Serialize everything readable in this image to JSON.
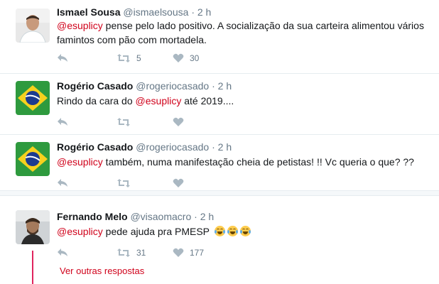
{
  "tweets": [
    {
      "fullname": "Ismael Sousa",
      "handle": "@ismaelsousa",
      "dot": "·",
      "time": "2 h",
      "mention": "@esuplicy",
      "text": " pense pelo lado positivo. A socialização da sua carteira alimentou vários famintos com pão com mortadela.",
      "retweets": "5",
      "likes": "30"
    },
    {
      "fullname": "Rogério Casado",
      "handle": "@rogeriocasado",
      "dot": "·",
      "time": "2 h",
      "text_before": "Rindo da cara do ",
      "mention": "@esuplicy",
      "text_after": " até 2019....",
      "retweets": "",
      "likes": ""
    },
    {
      "fullname": "Rogério Casado",
      "handle": "@rogeriocasado",
      "dot": "·",
      "time": "2 h",
      "mention": "@esuplicy",
      "text": " também, numa manifestação cheia de petistas! !! Vc queria o que? ??",
      "retweets": "",
      "likes": ""
    },
    {
      "fullname": "Fernando Melo",
      "handle": "@visaomacro",
      "dot": "·",
      "time": "2 h",
      "mention": "@esuplicy",
      "text": " pede ajuda pra PMESP ",
      "retweets": "31",
      "likes": "177"
    }
  ],
  "more_replies_label": "Ver outras respostas",
  "colors": {
    "mention": "#d0021b",
    "meta": "#657786",
    "icon": "#aab8c2",
    "thread_line": "#e0245e"
  },
  "icons": [
    "reply-icon",
    "retweet-icon",
    "like-icon",
    "tears-of-joy-emoji"
  ]
}
